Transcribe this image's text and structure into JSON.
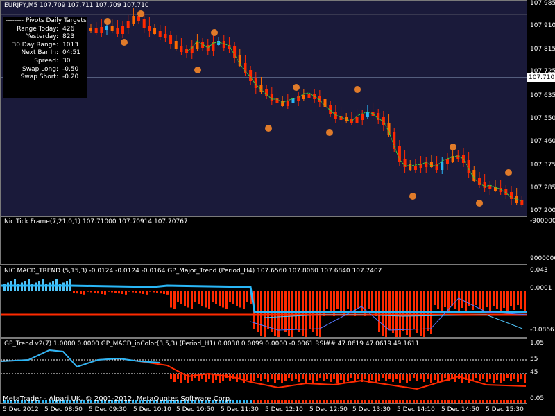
{
  "main_panel": {
    "title": "EURJPY,M5  107.709 107.711 107.709 107.710",
    "scale": [
      "107.985",
      "107.910",
      "107.815",
      "107.725",
      "107.635",
      "107.550",
      "107.460",
      "107.375",
      "107.285",
      "107.200"
    ],
    "current_price": "107.710",
    "info": {
      "header": "--------  Pivots Daily Targets",
      "rows": [
        {
          "k": "Range  Today:",
          "v": "426"
        },
        {
          "k": "Yesterday:",
          "v": "823"
        },
        {
          "k": "30 Day Range:",
          "v": "1013"
        },
        {
          "k": "Next Bar In:",
          "v": "04:51"
        },
        {
          "k": "Spread:",
          "v": "30"
        },
        {
          "k": "Swap  Long:",
          "v": "-0.50"
        },
        {
          "k": "Swap  Short:",
          "v": "-0.20"
        }
      ]
    }
  },
  "tick_panel": {
    "title": "Nic Tick Frame(7,21,0,1) 107.71000 107.70914 107.70767",
    "scale": [
      "-9000000",
      "9000000"
    ]
  },
  "macd_panel": {
    "title": "NIC MACD_TREND (5,15,3) -0.0124 -0.0124 -0.0164  GP_Major_Trend (Period_H4) 107.6560 107.8060 107.6840 107.7407",
    "scale": [
      "0.043",
      "0.0001",
      "-0.0866"
    ]
  },
  "rsi_panel": {
    "title": "GP_Trend v2(7) 1.0000 0.0000  GP_MACD_inColor(3,5,3) (Period_H1) 0.0038 0.0099 0.0000 -0.0061  RSI## 47.0619 47.0619 49.1611",
    "scale": [
      "1.05",
      "55",
      "45",
      "0.05"
    ]
  },
  "xaxis": [
    "5 Dec 2012",
    "5 Dec 08:50",
    "5 Dec 09:30",
    "5 Dec 10:10",
    "5 Dec 10:50",
    "5 Dec 11:30",
    "5 Dec 12:10",
    "5 Dec 12:50",
    "5 Dec 13:30",
    "5 Dec 14:10",
    "5 Dec 14:50",
    "5 Dec 15:30"
  ],
  "copyright": "MetaTrader - Alpari UK, © 2001-2012, MetaQuotes Software Corp.",
  "colors": {
    "main_bg": "#1a1a3a",
    "bull": "#29b6f6",
    "bear": "#ff2a00",
    "fractal": "#e07b2a",
    "ma": "#3ad03a"
  }
}
